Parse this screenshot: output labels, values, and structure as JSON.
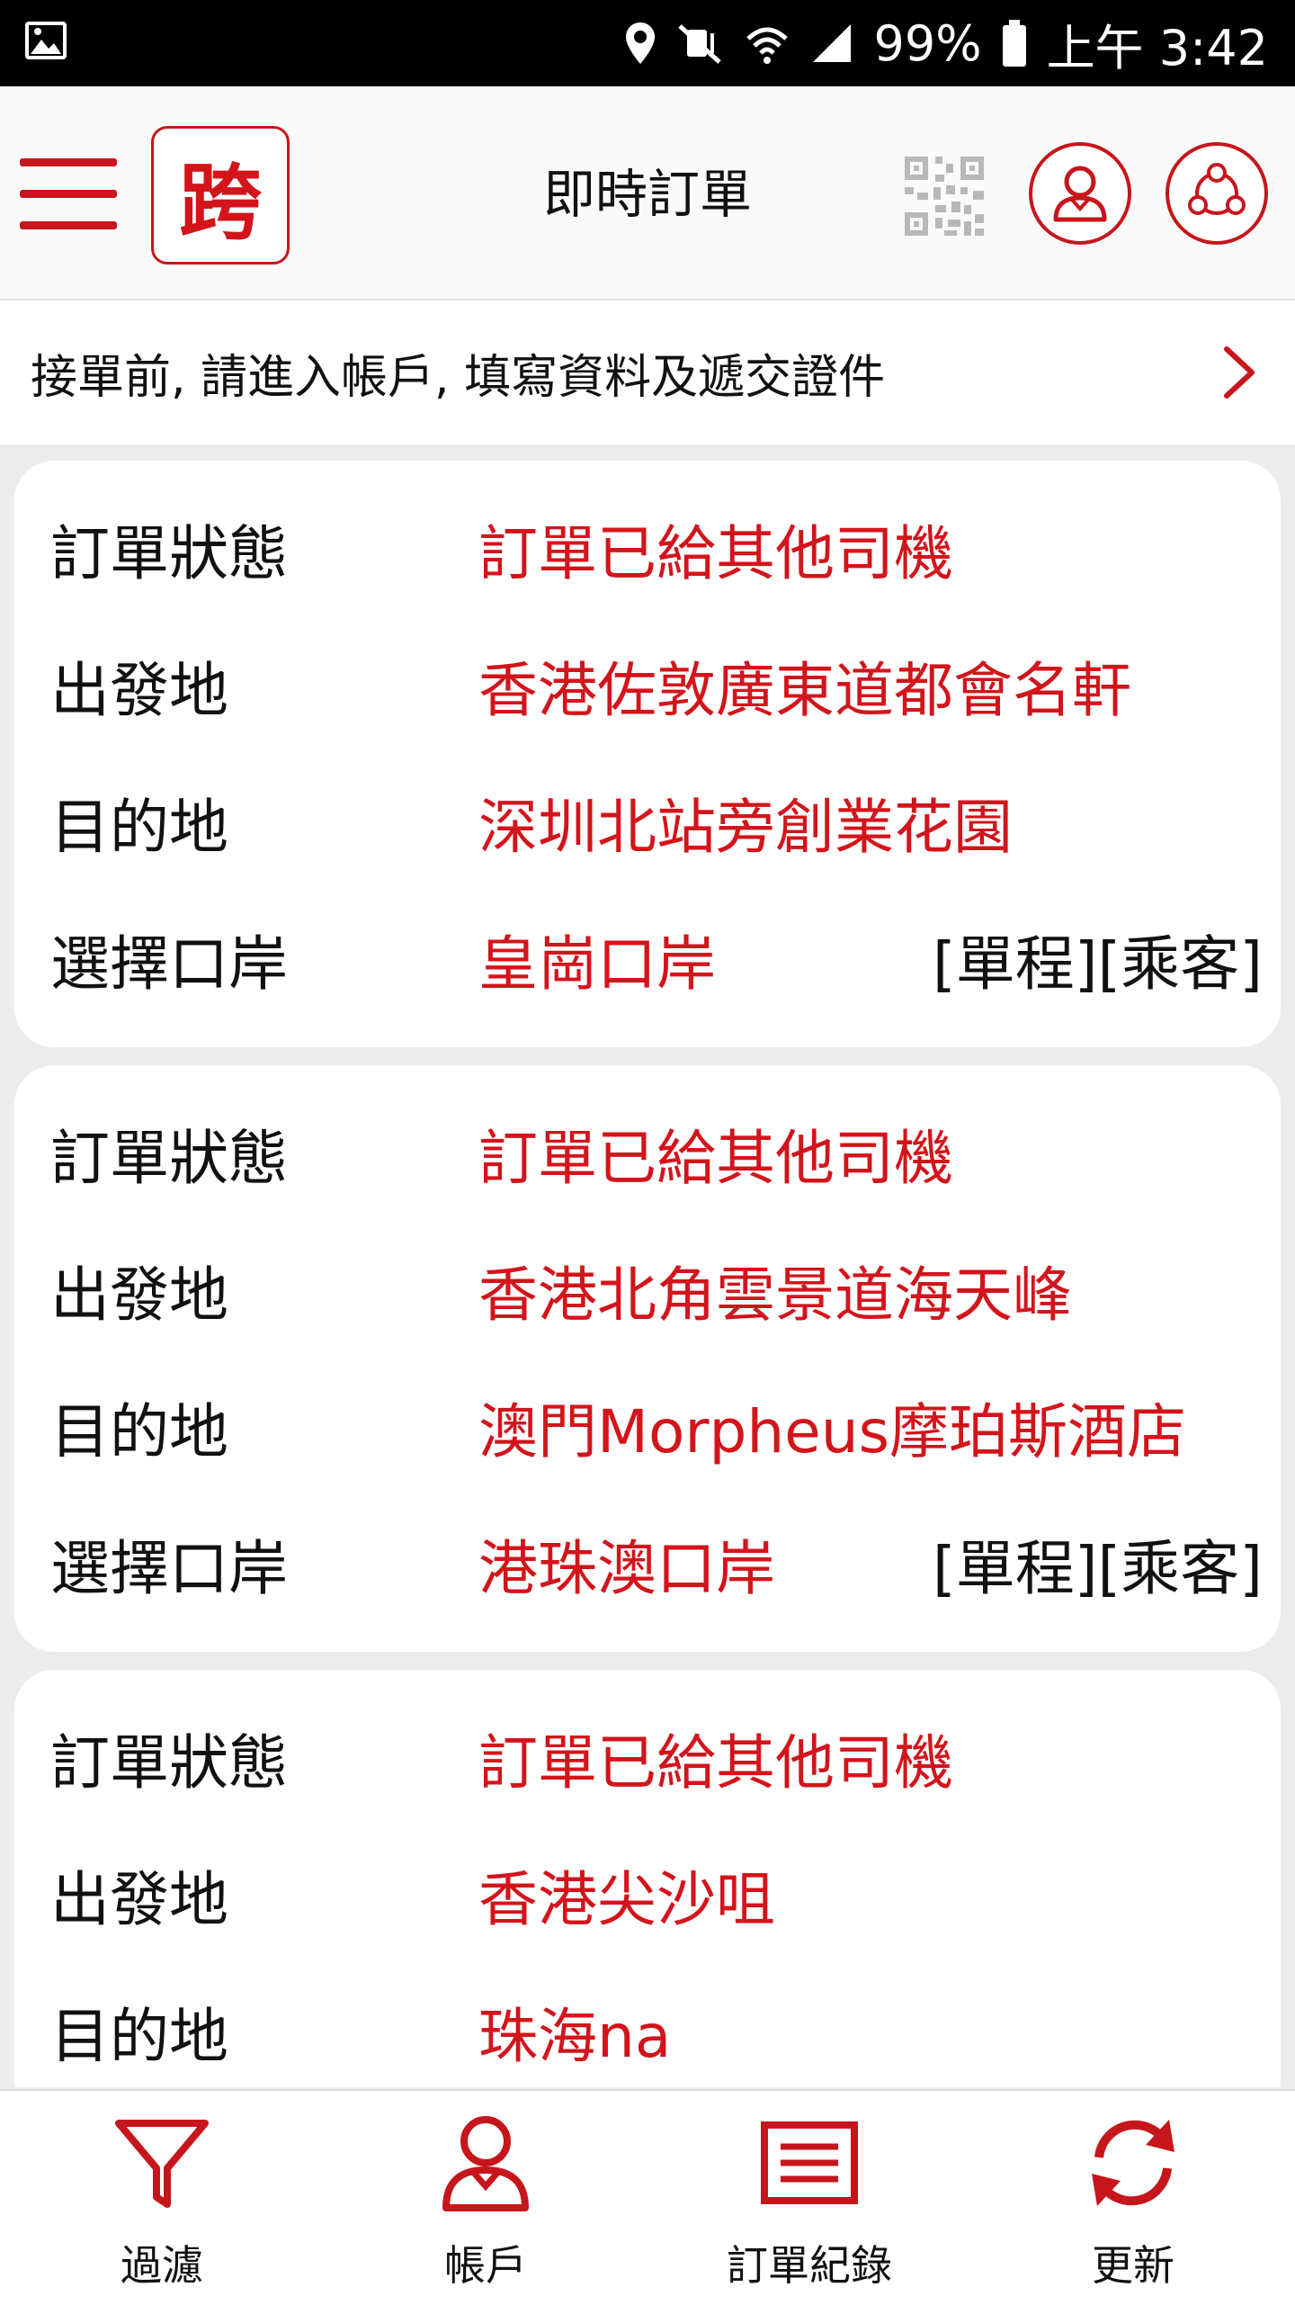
{
  "status_bar": {
    "battery": "99%",
    "time": "上午 3:42",
    "icons": [
      "image-icon",
      "location-icon",
      "mute-icon",
      "wifi-icon",
      "signal-icon",
      "battery-icon"
    ]
  },
  "header": {
    "title": "即時訂單",
    "logo_text": "跨",
    "icons": [
      "menu-icon",
      "qr-code-icon",
      "user-icon",
      "share-icon"
    ]
  },
  "notice": {
    "text": "接單前, 請進入帳戶, 填寫資料及遞交證件"
  },
  "labels": {
    "status": "訂單狀態",
    "origin": "出發地",
    "destination": "目的地",
    "port": "選擇口岸"
  },
  "orders": [
    {
      "status": "訂單已給其他司機",
      "origin": "香港佐敦廣東道都會名軒",
      "destination": "深圳北站旁創業花園",
      "port": "皇崗口岸",
      "tags": "[單程][乘客]"
    },
    {
      "status": "訂單已給其他司機",
      "origin": "香港北角雲景道海天峰",
      "destination": "澳門Morpheus摩珀斯酒店",
      "port": "港珠澳口岸",
      "tags": "[單程][乘客]"
    },
    {
      "status": "訂單已給其他司機",
      "origin": "香港尖沙咀",
      "destination": "珠海na"
    }
  ],
  "bottom_nav": [
    {
      "label": "過濾",
      "icon": "filter-icon"
    },
    {
      "label": "帳戶",
      "icon": "user-icon"
    },
    {
      "label": "訂單紀錄",
      "icon": "list-icon"
    },
    {
      "label": "更新",
      "icon": "refresh-icon"
    }
  ],
  "colors": {
    "accent": "#c6161c",
    "value_text": "#d3141b",
    "background": "#ececec"
  }
}
